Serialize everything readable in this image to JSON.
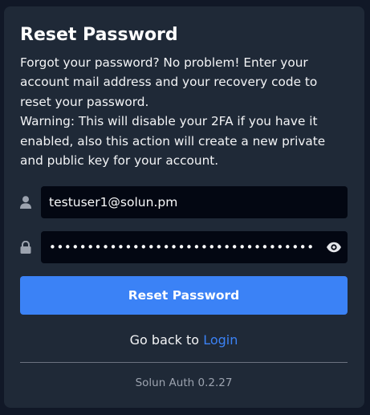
{
  "form": {
    "title": "Reset Password",
    "description_lines": [
      "Forgot your password? No problem! Enter your account mail address and your recovery code to reset your password.",
      "Warning: This will disable your 2FA if you have it enabled, also this action will create a new private and public key for your account."
    ],
    "email_value": "testuser1@solun.pm",
    "password_value": "••••••••••••••••••••••••••••••••••••",
    "submit_label": "Reset Password",
    "back_text": "Go back to",
    "back_link_label": "Login"
  },
  "footer": {
    "version": "Solun Auth 0.2.27"
  },
  "icons": {
    "email": "user-icon",
    "password": "lock-icon",
    "toggle": "eye-icon"
  },
  "colors": {
    "background": "#111827",
    "card": "#1f2937",
    "field": "#030712",
    "accent": "#3b82f6",
    "muted": "#9ca3af"
  }
}
